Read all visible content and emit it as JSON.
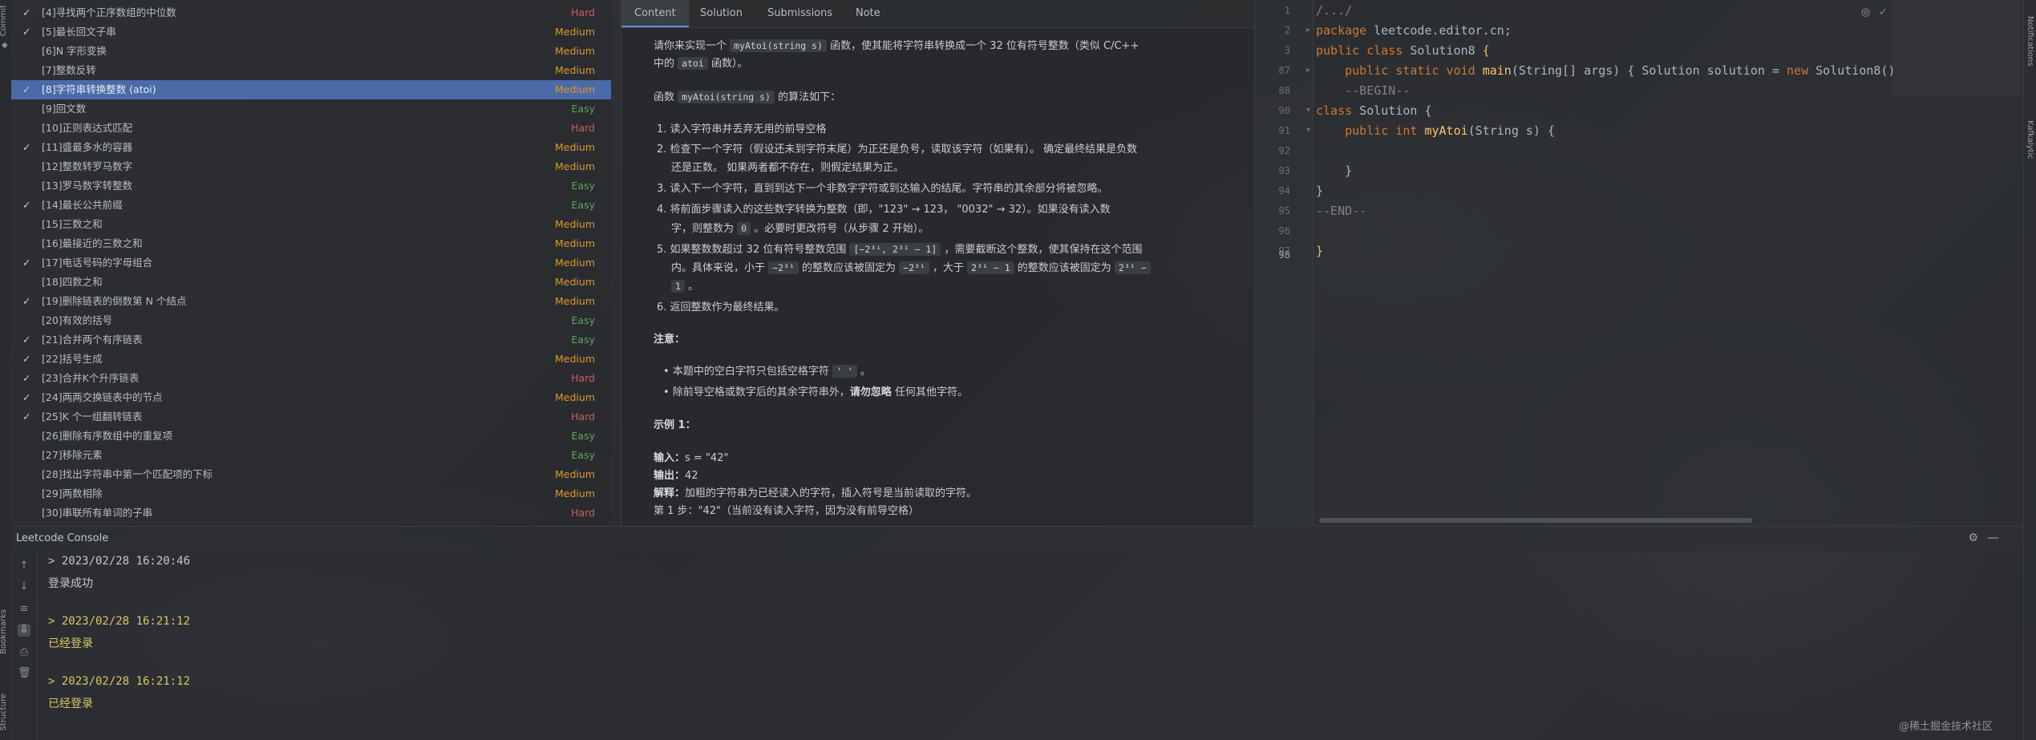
{
  "side_strip": {
    "top_label": "Commit",
    "bottom_labels": [
      "Bookmarks",
      "Structure"
    ],
    "right_labels": [
      "Notifications",
      "Kafkalytic"
    ]
  },
  "problem_list": [
    {
      "checked": true,
      "title": "[4]寻找两个正序数组的中位数",
      "difficulty": "Hard",
      "level": "hard"
    },
    {
      "checked": true,
      "title": "[5]最长回文子串",
      "difficulty": "Medium",
      "level": "medium"
    },
    {
      "checked": false,
      "title": "[6]N 字形变换",
      "difficulty": "Medium",
      "level": "medium"
    },
    {
      "checked": false,
      "title": "[7]整数反转",
      "difficulty": "Medium",
      "level": "medium"
    },
    {
      "checked": true,
      "title": "[8]字符串转换整数 (atoi)",
      "difficulty": "Medium",
      "level": "medium",
      "selected": true
    },
    {
      "checked": false,
      "title": "[9]回文数",
      "difficulty": "Easy",
      "level": "easy"
    },
    {
      "checked": false,
      "title": "[10]正则表达式匹配",
      "difficulty": "Hard",
      "level": "hard"
    },
    {
      "checked": true,
      "title": "[11]盛最多水的容器",
      "difficulty": "Medium",
      "level": "medium"
    },
    {
      "checked": false,
      "title": "[12]整数转罗马数字",
      "difficulty": "Medium",
      "level": "medium"
    },
    {
      "checked": false,
      "title": "[13]罗马数字转整数",
      "difficulty": "Easy",
      "level": "easy"
    },
    {
      "checked": true,
      "title": "[14]最长公共前缀",
      "difficulty": "Easy",
      "level": "easy"
    },
    {
      "checked": false,
      "title": "[15]三数之和",
      "difficulty": "Medium",
      "level": "medium"
    },
    {
      "checked": false,
      "title": "[16]最接近的三数之和",
      "difficulty": "Medium",
      "level": "medium"
    },
    {
      "checked": true,
      "title": "[17]电话号码的字母组合",
      "difficulty": "Medium",
      "level": "medium"
    },
    {
      "checked": false,
      "title": "[18]四数之和",
      "difficulty": "Medium",
      "level": "medium"
    },
    {
      "checked": true,
      "title": "[19]删除链表的倒数第 N 个结点",
      "difficulty": "Medium",
      "level": "medium"
    },
    {
      "checked": false,
      "title": "[20]有效的括号",
      "difficulty": "Easy",
      "level": "easy"
    },
    {
      "checked": true,
      "title": "[21]合并两个有序链表",
      "difficulty": "Easy",
      "level": "easy"
    },
    {
      "checked": true,
      "title": "[22]括号生成",
      "difficulty": "Medium",
      "level": "medium"
    },
    {
      "checked": true,
      "title": "[23]合并K个升序链表",
      "difficulty": "Hard",
      "level": "hard"
    },
    {
      "checked": true,
      "title": "[24]两两交换链表中的节点",
      "difficulty": "Medium",
      "level": "medium"
    },
    {
      "checked": true,
      "title": "[25]K 个一组翻转链表",
      "difficulty": "Hard",
      "level": "hard"
    },
    {
      "checked": false,
      "title": "[26]删除有序数组中的重复项",
      "difficulty": "Easy",
      "level": "easy"
    },
    {
      "checked": false,
      "title": "[27]移除元素",
      "difficulty": "Easy",
      "level": "easy"
    },
    {
      "checked": false,
      "title": "[28]找出字符串中第一个匹配项的下标",
      "difficulty": "Medium",
      "level": "medium"
    },
    {
      "checked": false,
      "title": "[29]两数相除",
      "difficulty": "Medium",
      "level": "medium"
    },
    {
      "checked": false,
      "title": "[30]串联所有单词的子串",
      "difficulty": "Hard",
      "level": "hard"
    }
  ],
  "content_tabs": [
    "Content",
    "Solution",
    "Submissions",
    "Note"
  ],
  "content": {
    "intro_a": "请你来实现一个",
    "intro_code": "myAtoi(string s)",
    "intro_b": "函数，使其能将字符串转换成一个 32 位有符号整数（类似 C/C++",
    "intro_c": "中的",
    "intro_code2": "atoi",
    "intro_d": "函数）。",
    "algo_a": "函数",
    "algo_code": "myAtoi(string s)",
    "algo_b": "的算法如下：",
    "steps": [
      "1. 读入字符串并丢弃无用的前导空格",
      "2. 检查下一个字符（假设还未到字符末尾）为正还是负号，读取该字符（如果有）。 确定最终结果是负数",
      "还是正数。 如果两者都不存在，则假定结果为正。",
      "3. 读入下一个字符，直到到达下一个非数字字符或到达输入的结尾。字符串的其余部分将被忽略。",
      "4. 将前面步骤读入的这些数字转换为整数（即，\"123\" → 123， \"0032\" → 32）。如果没有读入数",
      "字，则整数为",
      "。必要时更改符号（从步骤 2 开始）。",
      "5. 如果整数数超过 32 位有符号整数范围",
      "，需要截断这个整数，使其保持在这个范围",
      "内。具体来说，小于",
      "的整数应该被固定为",
      "，大于",
      "的整数应该被固定为",
      "。",
      "6. 返回整数作为最终结果。"
    ],
    "zero_code": "0",
    "range_code": "[−2³¹,  2³¹ − 1]",
    "neg_code": "−2³¹",
    "neg_code2": "−2³¹",
    "pos_code": "2³¹ − 1",
    "pos_code2a": "2³¹ −",
    "pos_code2b": "1",
    "note_title": "注意：",
    "note_1a": "本题中的空白字符只包括空格字符",
    "note_1_code": "' '",
    "note_1b": "。",
    "note_2a": "除前导空格或数字后的其余字符串外，",
    "note_2_bold": "请勿忽略",
    "note_2b": "任何其他字符。",
    "example_title": "示例 1：",
    "ex_input_label": "输入：",
    "ex_input": "s = \"42\"",
    "ex_output_label": "输出：",
    "ex_output": "42",
    "ex_expl_label": "解释：",
    "ex_expl": "加粗的字符串为已经读入的字符，插入符号是当前读取的字符。",
    "ex_step1": "第 1 步：\"42\"（当前没有读入字符，因为没有前导空格）"
  },
  "editor": {
    "line_numbers": [
      "1",
      "2",
      "3",
      "87",
      "88",
      "90",
      "91",
      "92",
      "93",
      "94",
      "95",
      "96",
      "97",
      "98"
    ],
    "lines": {
      "l1": "/.../",
      "l2_kw": "package",
      "l2": " leetcode.editor.cn;",
      "l3_kw": "public class",
      "l3": " Solution8 ",
      "l87_kw": "public static void",
      "l87_fn": " main",
      "l87": "(String[] args) { Solution solution = ",
      "l87_kw2": "new",
      "l87_b": " Solution8()",
      "l88": "--BEGIN--",
      "l90_kw": "class",
      "l90": " Solution {",
      "l91_kw": "public int",
      "l91_fn": " myAtoi",
      "l91": "(String s) {",
      "l93": "}",
      "l94": "}",
      "l95": "}",
      "l96": "--END--",
      "l98": "}"
    }
  },
  "console": {
    "title": "Leetcode Console",
    "entries": [
      {
        "time": "> 2023/02/28 16:20:46",
        "message": "登录成功",
        "style": "gray"
      },
      {
        "time": "> 2023/02/28 16:21:12",
        "message": "已经登录",
        "style": "yellow"
      },
      {
        "time": "> 2023/02/28 16:21:12",
        "message": "已经登录",
        "style": "yellow"
      }
    ]
  },
  "watermark": "@稀土掘金技术社区",
  "colors": {
    "hard": "#d35b5b",
    "medium": "#d79a32",
    "easy": "#5fa55f",
    "selected": "#4a6aa8"
  }
}
